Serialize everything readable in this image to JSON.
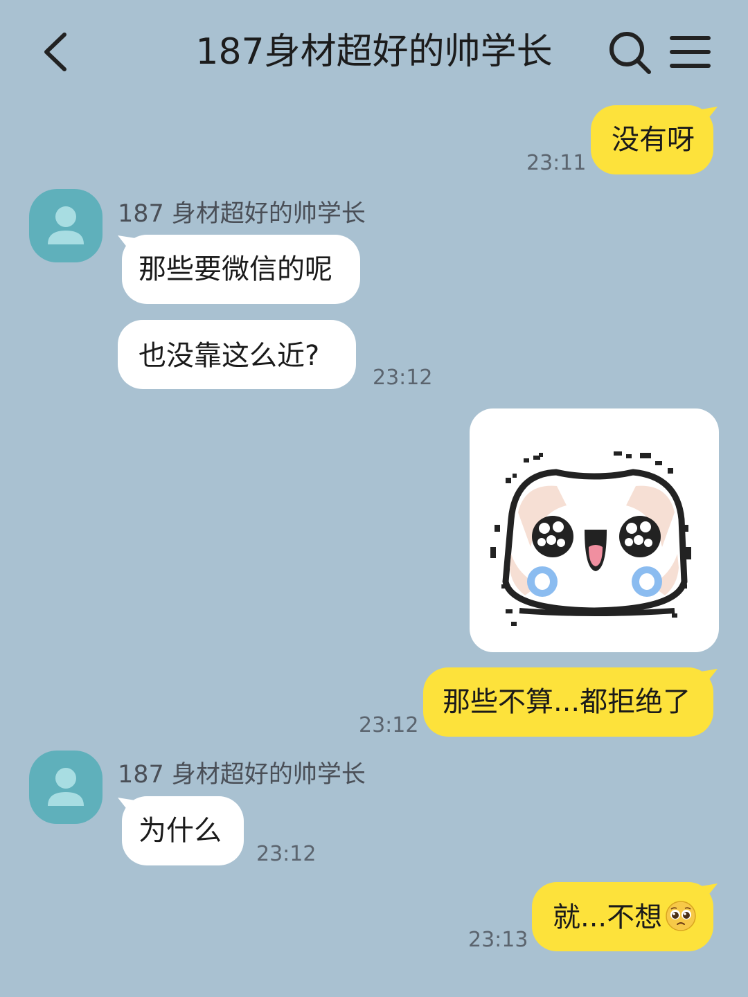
{
  "header": {
    "title": "187身材超好的帅学长",
    "back_icon": "chevron-left-icon",
    "search_icon": "search-icon",
    "menu_icon": "menu-icon"
  },
  "colors": {
    "background": "#a9c1d1",
    "outgoing_bubble": "#fde23b",
    "incoming_bubble": "#ffffff",
    "avatar": "#5fb0bb"
  },
  "messages": [
    {
      "direction": "out",
      "text": "没有呀",
      "time": "23:11"
    },
    {
      "direction": "in",
      "sender": "187 身材超好的帅学长",
      "text": "那些要微信的呢"
    },
    {
      "direction": "in",
      "text": "也没靠这么近?",
      "time": "23:12"
    },
    {
      "direction": "out",
      "type": "sticker",
      "sticker": "crying-cat-sticker"
    },
    {
      "direction": "out",
      "text": "那些不算...都拒绝了",
      "time": "23:12"
    },
    {
      "direction": "in",
      "sender": "187 身材超好的帅学长",
      "text": "为什么",
      "time": "23:12"
    },
    {
      "direction": "out",
      "text": "就...不想",
      "emoji": "pleading-face-emoji",
      "time": "23:13"
    }
  ]
}
